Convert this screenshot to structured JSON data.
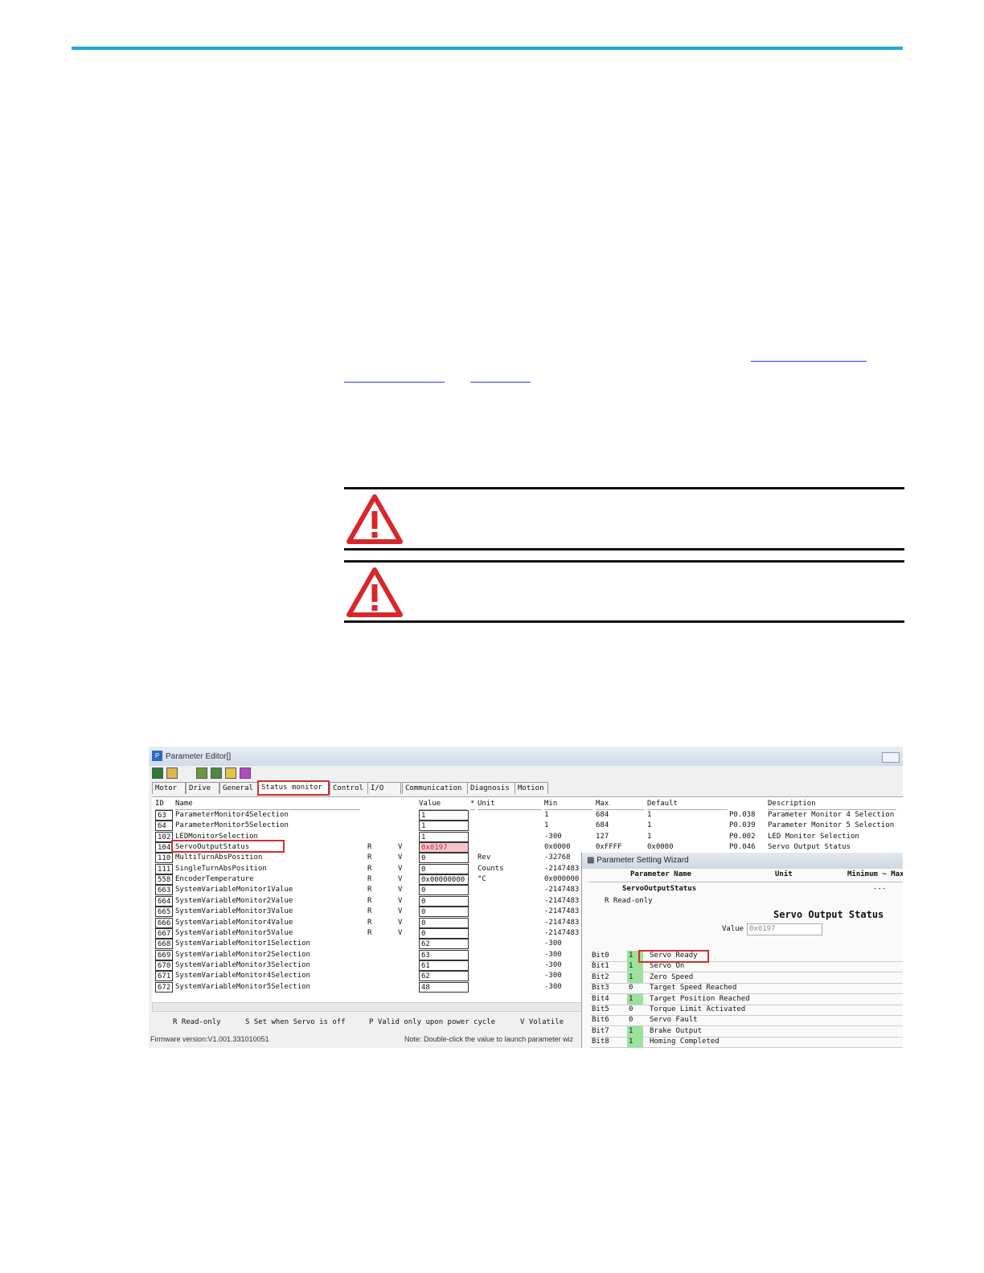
{
  "document": {
    "link_1": "",
    "link_2": "",
    "link_3": ""
  },
  "window": {
    "title": "Parameter Editor[]",
    "firmware": "Firmware version:V1.001.331010051",
    "note": "Note: Double-click the value to launch parameter wiz"
  },
  "tabs": [
    "Motor",
    "Drive",
    "General",
    "Status monitor",
    "Control",
    "I/O",
    "Communication",
    "Diagnosis",
    "Motion"
  ],
  "active_tab": "Status monitor",
  "table": {
    "headers": {
      "id": "ID",
      "name": "Name",
      "value": "Value",
      "star": "*",
      "unit": "Unit",
      "min": "Min",
      "max": "Max",
      "default": "Default",
      "description": "Description"
    },
    "rows": [
      {
        "id": "63",
        "name": "ParameterMonitor4Selection",
        "r": "",
        "v": "",
        "value": "1",
        "unit": "",
        "min": "1",
        "max": "684",
        "default": "1",
        "code": "P0.038",
        "desc": "Parameter Monitor 4 Selection"
      },
      {
        "id": "64",
        "name": "ParameterMonitor5Selection",
        "r": "",
        "v": "",
        "value": "1",
        "unit": "",
        "min": "1",
        "max": "684",
        "default": "1",
        "code": "P0.039",
        "desc": "Parameter Monitor 5 Selection"
      },
      {
        "id": "102",
        "name": "LEDMonitorSelection",
        "r": "",
        "v": "",
        "value": "1",
        "unit": "",
        "min": "-300",
        "max": "127",
        "default": "1",
        "code": "P0.002",
        "desc": "LED Monitor Selection"
      },
      {
        "id": "104",
        "name": "ServoOutputStatus",
        "r": "R",
        "v": "V",
        "value": "0x0197",
        "unit": "",
        "min": "0x0000",
        "max": "0xFFFF",
        "default": "0x0000",
        "code": "P0.046",
        "desc": "Servo Output Status"
      },
      {
        "id": "110",
        "name": "MultiTurnAbsPosition",
        "r": "R",
        "v": "V",
        "value": "0",
        "unit": "Rev",
        "min": "-32768",
        "max": "",
        "default": "",
        "code": "",
        "desc": ""
      },
      {
        "id": "111",
        "name": "SingleTurnAbsPosition",
        "r": "R",
        "v": "V",
        "value": "0",
        "unit": "Counts",
        "min": "-2147483",
        "max": "",
        "default": "",
        "code": "",
        "desc": ""
      },
      {
        "id": "558",
        "name": "EncoderTemperature",
        "r": "R",
        "v": "V",
        "value": "0x00000000",
        "unit": "°C",
        "min": "0x000000",
        "max": "",
        "default": "",
        "code": "",
        "desc": ""
      },
      {
        "id": "663",
        "name": "SystemVariableMonitor1Value",
        "r": "R",
        "v": "V",
        "value": "0",
        "unit": "",
        "min": "-2147483",
        "max": "",
        "default": "",
        "code": "",
        "desc": ""
      },
      {
        "id": "664",
        "name": "SystemVariableMonitor2Value",
        "r": "R",
        "v": "V",
        "value": "0",
        "unit": "",
        "min": "-2147483",
        "max": "",
        "default": "",
        "code": "",
        "desc": ""
      },
      {
        "id": "665",
        "name": "SystemVariableMonitor3Value",
        "r": "R",
        "v": "V",
        "value": "0",
        "unit": "",
        "min": "-2147483",
        "max": "",
        "default": "",
        "code": "",
        "desc": ""
      },
      {
        "id": "666",
        "name": "SystemVariableMonitor4Value",
        "r": "R",
        "v": "V",
        "value": "0",
        "unit": "",
        "min": "-2147483",
        "max": "",
        "default": "",
        "code": "",
        "desc": ""
      },
      {
        "id": "667",
        "name": "SystemVariableMonitor5Value",
        "r": "R",
        "v": "V",
        "value": "0",
        "unit": "",
        "min": "-2147483",
        "max": "",
        "default": "",
        "code": "",
        "desc": ""
      },
      {
        "id": "668",
        "name": "SystemVariableMonitor1Selection",
        "r": "",
        "v": "",
        "value": "62",
        "unit": "",
        "min": "-300",
        "max": "",
        "default": "",
        "code": "",
        "desc": ""
      },
      {
        "id": "669",
        "name": "SystemVariableMonitor2Selection",
        "r": "",
        "v": "",
        "value": "63",
        "unit": "",
        "min": "-300",
        "max": "",
        "default": "",
        "code": "",
        "desc": ""
      },
      {
        "id": "670",
        "name": "SystemVariableMonitor3Selection",
        "r": "",
        "v": "",
        "value": "61",
        "unit": "",
        "min": "-300",
        "max": "",
        "default": "",
        "code": "",
        "desc": ""
      },
      {
        "id": "671",
        "name": "SystemVariableMonitor4Selection",
        "r": "",
        "v": "",
        "value": "62",
        "unit": "",
        "min": "-300",
        "max": "",
        "default": "",
        "code": "",
        "desc": ""
      },
      {
        "id": "672",
        "name": "SystemVariableMonitor5Selection",
        "r": "",
        "v": "",
        "value": "48",
        "unit": "",
        "min": "-300",
        "max": "",
        "default": "",
        "code": "",
        "desc": ""
      }
    ]
  },
  "legend": {
    "r": "R  Read-only",
    "s": "S  Set when Servo is off",
    "p": "P  Valid only upon power cycle",
    "v": "V  Volatile"
  },
  "wizard": {
    "title": "Parameter Setting Wizard",
    "col_name": "Parameter Name",
    "col_unit": "Unit",
    "col_range": "Minimum ~ Max",
    "param_name": "ServoOutputStatus",
    "range_value": "---",
    "access": "R  Read-only",
    "heading": "Servo Output Status",
    "value_label": "Value",
    "value": "0x0197",
    "bits": [
      {
        "bit": "Bit0",
        "val": "1",
        "label": "Servo Ready"
      },
      {
        "bit": "Bit1",
        "val": "1",
        "label": "Servo On"
      },
      {
        "bit": "Bit2",
        "val": "1",
        "label": "Zero Speed"
      },
      {
        "bit": "Bit3",
        "val": "0",
        "label": "Target Speed Reached"
      },
      {
        "bit": "Bit4",
        "val": "1",
        "label": "Target Position Reached"
      },
      {
        "bit": "Bit5",
        "val": "0",
        "label": "Torque Limit Activated"
      },
      {
        "bit": "Bit6",
        "val": "0",
        "label": "Servo Fault"
      },
      {
        "bit": "Bit7",
        "val": "1",
        "label": "Brake Output"
      },
      {
        "bit": "Bit8",
        "val": "1",
        "label": "Homing Completed"
      }
    ]
  },
  "colors": {
    "accent_rule": "#1ea8e0",
    "highlight": "#d32f2f",
    "warning": "#d9262b",
    "bit_on": "#9be29b"
  }
}
